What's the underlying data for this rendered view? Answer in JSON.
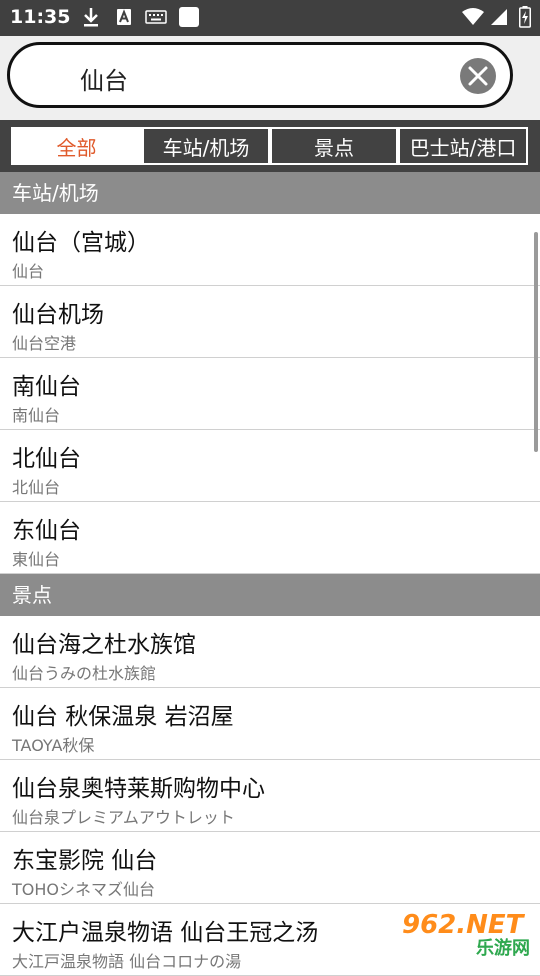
{
  "status_bar": {
    "time": "11:35",
    "left_icons": [
      "download-icon",
      "keyboard-a-icon",
      "keyboard-icon",
      "square-icon"
    ],
    "right_icons": [
      "wifi-icon",
      "signal-icon",
      "battery-charging-icon"
    ]
  },
  "search": {
    "query": "仙台"
  },
  "tabs": [
    {
      "label": "全部",
      "active": true
    },
    {
      "label": "车站/机场",
      "active": false
    },
    {
      "label": "景点",
      "active": false
    },
    {
      "label": "巴士站/港口",
      "active": false
    }
  ],
  "sections": [
    {
      "header": "车站/机场",
      "items": [
        {
          "title": "仙台（宫城）",
          "subtitle": "仙台"
        },
        {
          "title": "仙台机场",
          "subtitle": "仙台空港"
        },
        {
          "title": "南仙台",
          "subtitle": "南仙台"
        },
        {
          "title": "北仙台",
          "subtitle": "北仙台"
        },
        {
          "title": "东仙台",
          "subtitle": "東仙台"
        }
      ]
    },
    {
      "header": "景点",
      "items": [
        {
          "title": "仙台海之杜水族馆",
          "subtitle": "仙台うみの杜水族館"
        },
        {
          "title": "仙台 秋保温泉 岩沼屋",
          "subtitle": "TAOYA秋保"
        },
        {
          "title": "仙台泉奥特莱斯购物中心",
          "subtitle": "仙台泉プレミアムアウトレット"
        },
        {
          "title": "东宝影院 仙台",
          "subtitle": "TOHOシネマズ仙台"
        },
        {
          "title": "大江户温泉物语 仙台王冠之汤",
          "subtitle": "大江戸温泉物語 仙台コロナの湯"
        }
      ]
    }
  ],
  "watermark": {
    "line1": "962.NET",
    "line2": "乐游网"
  },
  "colors": {
    "status_bar": "#404040",
    "tab_bar": "#424242",
    "active_tab_text": "#e05a2b",
    "section_header": "#8c8c8c"
  }
}
